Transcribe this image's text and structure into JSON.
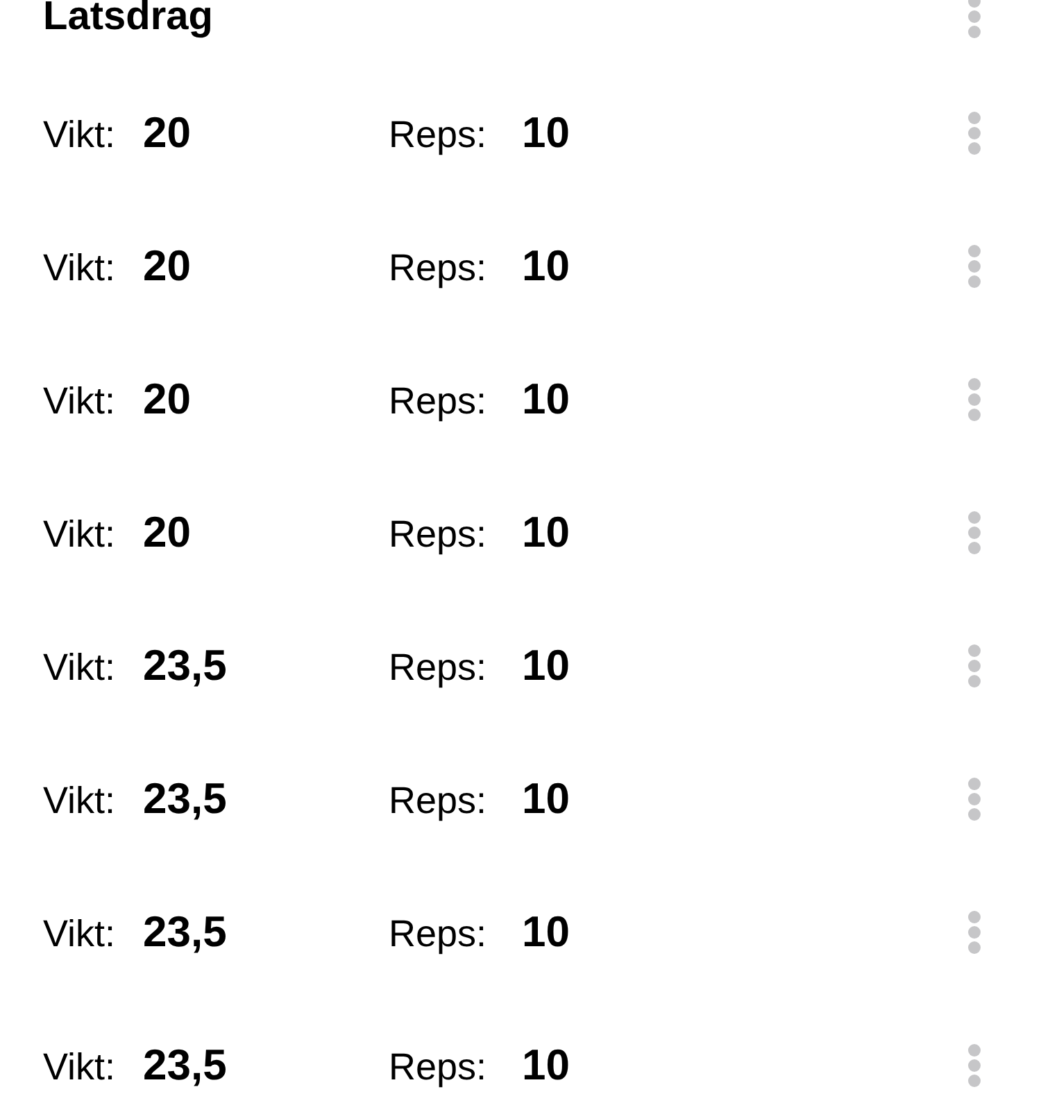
{
  "exercise": {
    "title": "Latsdrag"
  },
  "sets": [
    {
      "weight_label": "Vikt:",
      "weight": "20",
      "reps_label": "Reps:",
      "reps": "10"
    },
    {
      "weight_label": "Vikt:",
      "weight": "20",
      "reps_label": "Reps:",
      "reps": "10"
    },
    {
      "weight_label": "Vikt:",
      "weight": "20",
      "reps_label": "Reps:",
      "reps": "10"
    },
    {
      "weight_label": "Vikt:",
      "weight": "20",
      "reps_label": "Reps:",
      "reps": "10"
    },
    {
      "weight_label": "Vikt:",
      "weight": "23,5",
      "reps_label": "Reps:",
      "reps": "10"
    },
    {
      "weight_label": "Vikt:",
      "weight": "23,5",
      "reps_label": "Reps:",
      "reps": "10"
    },
    {
      "weight_label": "Vikt:",
      "weight": "23,5",
      "reps_label": "Reps:",
      "reps": "10"
    },
    {
      "weight_label": "Vikt:",
      "weight": "23,5",
      "reps_label": "Reps:",
      "reps": "10"
    }
  ]
}
